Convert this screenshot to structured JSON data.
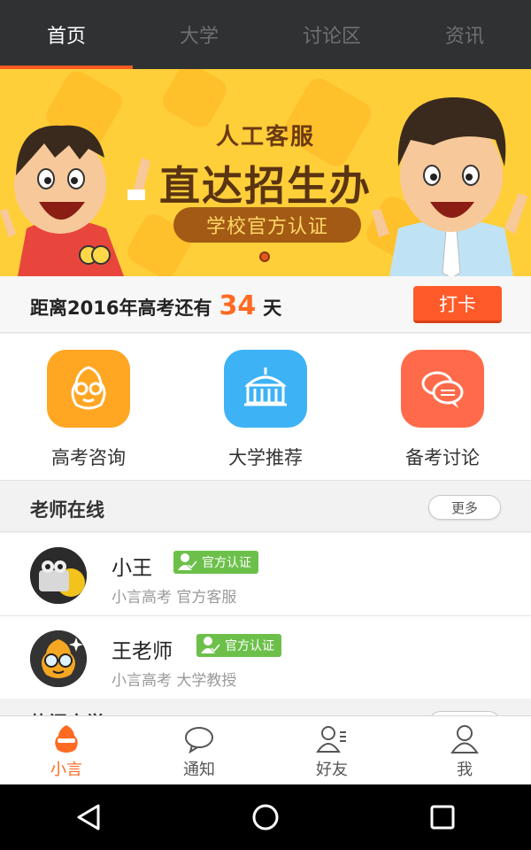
{
  "top_tabs": [
    {
      "label": "首页",
      "active": true
    },
    {
      "label": "大学",
      "active": false
    },
    {
      "label": "讨论区",
      "active": false
    },
    {
      "label": "资讯",
      "active": false
    }
  ],
  "banner": {
    "kicker": "人工客服",
    "headline": "直达招生办",
    "pill": "学校官方认证"
  },
  "countdown": {
    "prefix": "距离2016年高考还有",
    "days": "34",
    "suffix": "天",
    "checkin_label": "打卡"
  },
  "quick_links": [
    {
      "label": "高考咨询",
      "icon": "mascot-icon",
      "color": "#ffa623"
    },
    {
      "label": "大学推荐",
      "icon": "university-icon",
      "color": "#3db2f5"
    },
    {
      "label": "备考讨论",
      "icon": "chat-bubbles-icon",
      "color": "#ff6b4a"
    }
  ],
  "teachers": {
    "title": "老师在线",
    "more_label": "更多",
    "items": [
      {
        "name": "小王",
        "badge": "官方认证",
        "subtitle": "小言高考 官方客服"
      },
      {
        "name": "王老师",
        "badge": "官方认证",
        "subtitle": "小言高考 大学教授"
      }
    ]
  },
  "next_section_title": "热门大学",
  "bottom_nav": [
    {
      "label": "小言",
      "icon": "mascot-icon",
      "active": true
    },
    {
      "label": "通知",
      "icon": "chat-bubble-icon",
      "active": false
    },
    {
      "label": "好友",
      "icon": "friends-icon",
      "active": false
    },
    {
      "label": "我",
      "icon": "person-icon",
      "active": false
    }
  ],
  "colors": {
    "accent": "#ff6a22",
    "topbar": "#2f3133",
    "banner": "#ffcf3a",
    "verified": "#6cc04a"
  }
}
